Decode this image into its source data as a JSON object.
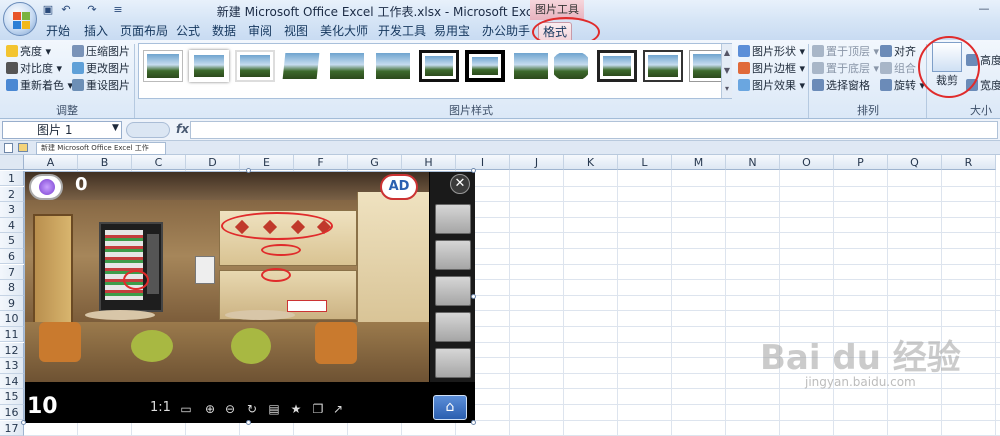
{
  "titlebar": {
    "title": "新建 Microsoft Office Excel 工作表.xlsx - Microsoft Excel",
    "tool_context": "图片工具"
  },
  "tabs": [
    "开始",
    "插入",
    "页面布局",
    "公式",
    "数据",
    "审阅",
    "视图",
    "美化大师",
    "开发工具",
    "易用宝",
    "办公助手",
    "格式"
  ],
  "ribbon": {
    "adjust": {
      "brightness": "亮度",
      "contrast": "对比度",
      "recolor": "重新着色",
      "compress": "压缩图片",
      "change_picture": "更改图片",
      "reset_picture": "重设图片",
      "label": "调整"
    },
    "styles": {
      "shape": "图片形状",
      "border": "图片边框",
      "effects": "图片效果",
      "label": "图片样式"
    },
    "arrange": {
      "bring_front": "置于顶层",
      "send_back": "置于底层",
      "selection_pane": "选择窗格",
      "align": "对齐",
      "group": "组合",
      "rotate": "旋转",
      "label": "排列"
    },
    "size": {
      "crop": "裁剪",
      "height": "高度",
      "width": "宽度",
      "label": "大小"
    }
  },
  "formula_bar": {
    "name_box": "图片 1",
    "fx": "fx"
  },
  "document_tab": "新建 Microsoft Office Excel 工作表.xlsx",
  "columns": [
    "A",
    "B",
    "C",
    "D",
    "E",
    "F",
    "G",
    "H",
    "I",
    "J",
    "K",
    "L",
    "M",
    "N",
    "O",
    "P",
    "Q",
    "R"
  ],
  "rows": [
    "1",
    "2",
    "3",
    "4",
    "5",
    "6",
    "7",
    "8",
    "9",
    "10",
    "11",
    "12",
    "13",
    "14",
    "15",
    "16",
    "17"
  ],
  "game": {
    "hint_count": "0",
    "ad_label": "AD",
    "level": "10",
    "zoom_label": "1:1",
    "close_glyph": "✕",
    "home_glyph": "⌂"
  },
  "watermark": {
    "main": "Bai du 经验",
    "sub": "jingyan.baidu.com"
  },
  "colors": {
    "highlight": "#e02b2b",
    "ribbon_bg": "#dbe8f7",
    "tab_active": "#f3d4da"
  }
}
